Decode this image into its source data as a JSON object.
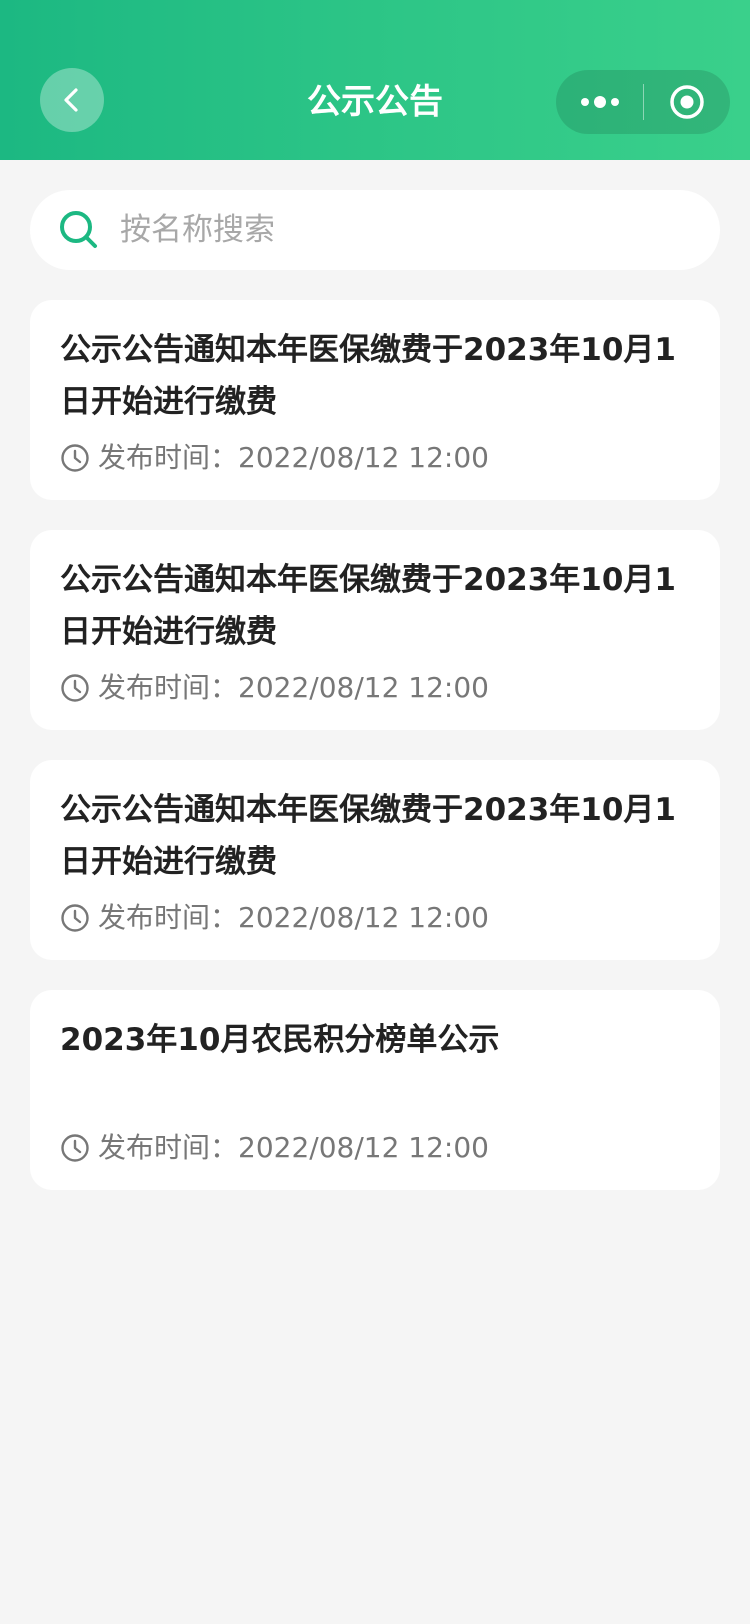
{
  "header": {
    "title": "公示公告",
    "background_start": "#1cb882",
    "background_end": "#3ad08b"
  },
  "search": {
    "placeholder": "按名称搜索",
    "icon_color": "#1cb882"
  },
  "notices": [
    {
      "title": "公示公告通知本年医保缴费于2023年10月1日开始进行缴费",
      "published_label": "发布时间：",
      "published_time": "2022/08/12 12:00"
    },
    {
      "title": "公示公告通知本年医保缴费于2023年10月1日开始进行缴费",
      "published_label": "发布时间：",
      "published_time": "2022/08/12 12:00"
    },
    {
      "title": "公示公告通知本年医保缴费于2023年10月1日开始进行缴费",
      "published_label": "发布时间：",
      "published_time": "2022/08/12 12:00"
    },
    {
      "title": "2023年10月农民积分榜单公示",
      "published_label": "发布时间：",
      "published_time": "2022/08/12 12:00"
    }
  ]
}
